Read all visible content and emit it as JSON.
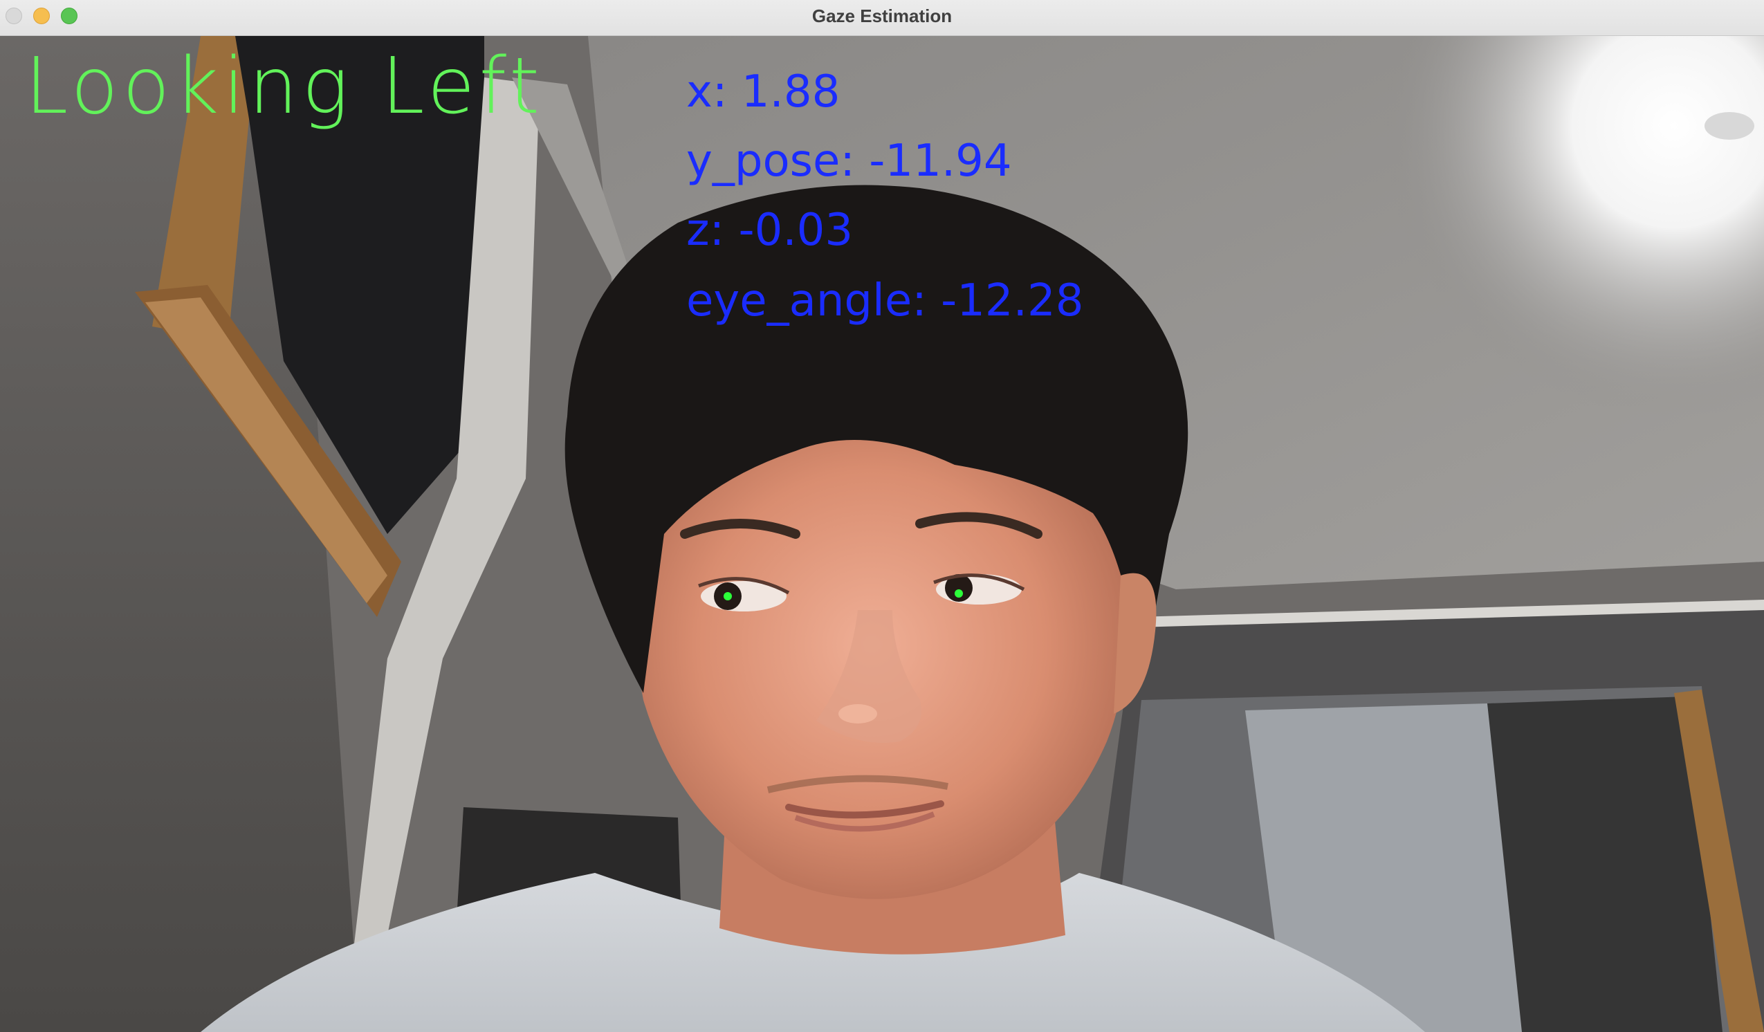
{
  "window": {
    "title": "Gaze Estimation"
  },
  "overlay": {
    "gaze_status": "Looking Left",
    "metrics": [
      {
        "label": "x:",
        "value": "1.88"
      },
      {
        "label": "y_pose:",
        "value": "-11.94"
      },
      {
        "label": "z:",
        "value": "-0.03"
      },
      {
        "label": "eye_angle:",
        "value": "-12.28"
      }
    ],
    "status_color": "#62f25a",
    "metrics_color": "#1a2cff",
    "eye_marker_color": "#2cff3a"
  },
  "camera_feed": {
    "description_icon": "webcam-frame"
  }
}
